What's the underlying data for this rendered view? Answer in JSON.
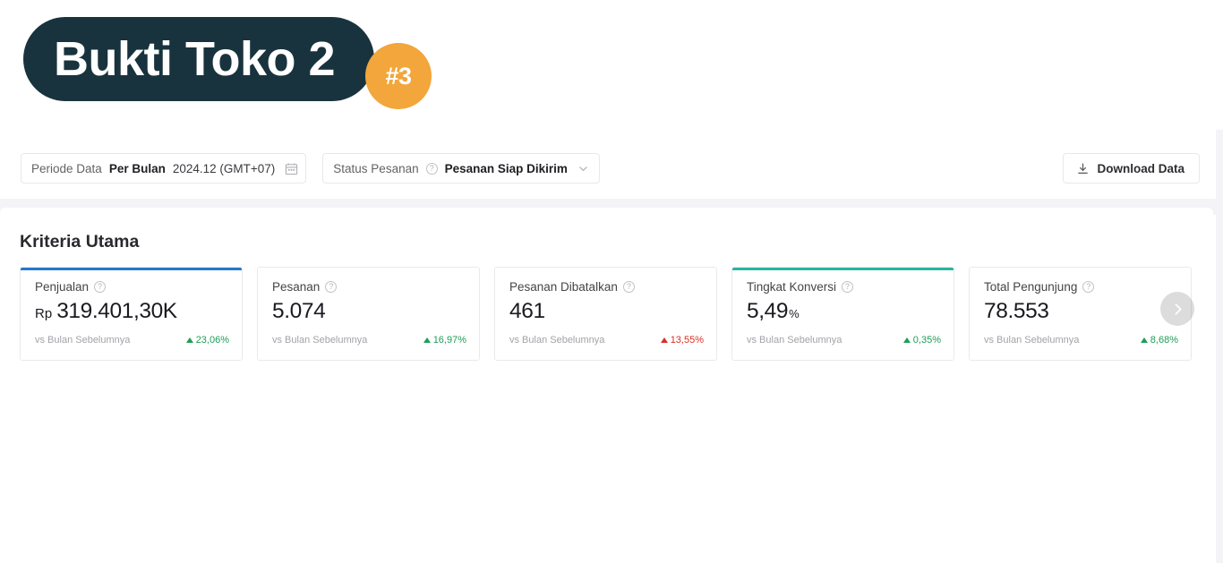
{
  "logo": {
    "title": "Bukti Toko 2",
    "rank_badge": "#3",
    "pill_color": "#18333d",
    "badge_color": "#f2a63b"
  },
  "filters": {
    "period": {
      "label": "Periode Data",
      "mode": "Per Bulan",
      "value": "2024.12 (GMT+07)",
      "calendar_icon": "calendar-icon"
    },
    "order_status": {
      "label": "Status Pesanan",
      "help_icon": "help-circle-icon",
      "value": "Pesanan Siap Dikirim",
      "chevron_icon": "chevron-down-icon"
    },
    "download": {
      "label": "Download Data",
      "icon": "download-icon"
    }
  },
  "main": {
    "section_title": "Kriteria Utama",
    "foot_label": "vs Bulan Sebelumnya",
    "carousel_next_icon": "chevron-right-icon",
    "cards": [
      {
        "title": "Penjualan",
        "help_icon": "help-circle-icon",
        "prefix": "Rp",
        "value": "319.401,30K",
        "suffix": "",
        "compare_label": "vs Bulan Sebelumnya",
        "delta": "23,06%",
        "delta_direction": "up",
        "delta_color": "#1f9d57",
        "accent_color": "#2878d0"
      },
      {
        "title": "Pesanan",
        "help_icon": "help-circle-icon",
        "prefix": "",
        "value": "5.074",
        "suffix": "",
        "compare_label": "vs Bulan Sebelumnya",
        "delta": "16,97%",
        "delta_direction": "up",
        "delta_color": "#1f9d57",
        "accent_color": "transparent"
      },
      {
        "title": "Pesanan Dibatalkan",
        "help_icon": "help-circle-icon",
        "prefix": "",
        "value": "461",
        "suffix": "",
        "compare_label": "vs Bulan Sebelumnya",
        "delta": "13,55%",
        "delta_direction": "up",
        "delta_color": "#d83025",
        "accent_color": "transparent"
      },
      {
        "title": "Tingkat Konversi",
        "help_icon": "help-circle-icon",
        "prefix": "",
        "value": "5,49",
        "suffix": "%",
        "compare_label": "vs Bulan Sebelumnya",
        "delta": "0,35%",
        "delta_direction": "up",
        "delta_color": "#1f9d57",
        "accent_color": "#2eb3a0"
      },
      {
        "title": "Total Pengunjung",
        "help_icon": "help-circle-icon",
        "prefix": "",
        "value": "78.553",
        "suffix": "",
        "compare_label": "vs Bulan Sebelumnya",
        "delta": "8,68%",
        "delta_direction": "up",
        "delta_color": "#1f9d57",
        "accent_color": "transparent"
      }
    ]
  }
}
